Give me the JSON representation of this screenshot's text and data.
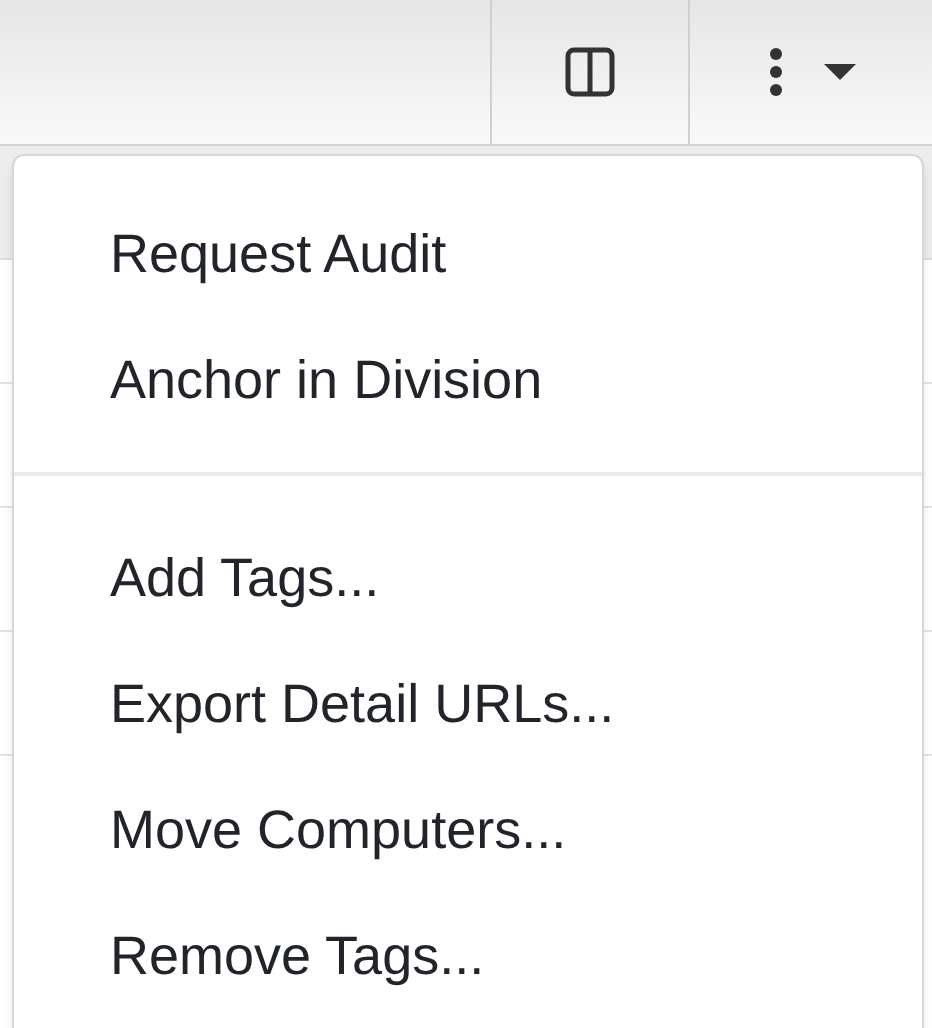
{
  "menu": {
    "sections": [
      {
        "items": [
          "Request Audit",
          "Anchor in Division"
        ]
      },
      {
        "items": [
          "Add Tags...",
          "Export Detail URLs...",
          "Move Computers...",
          "Remove Tags..."
        ]
      }
    ]
  }
}
